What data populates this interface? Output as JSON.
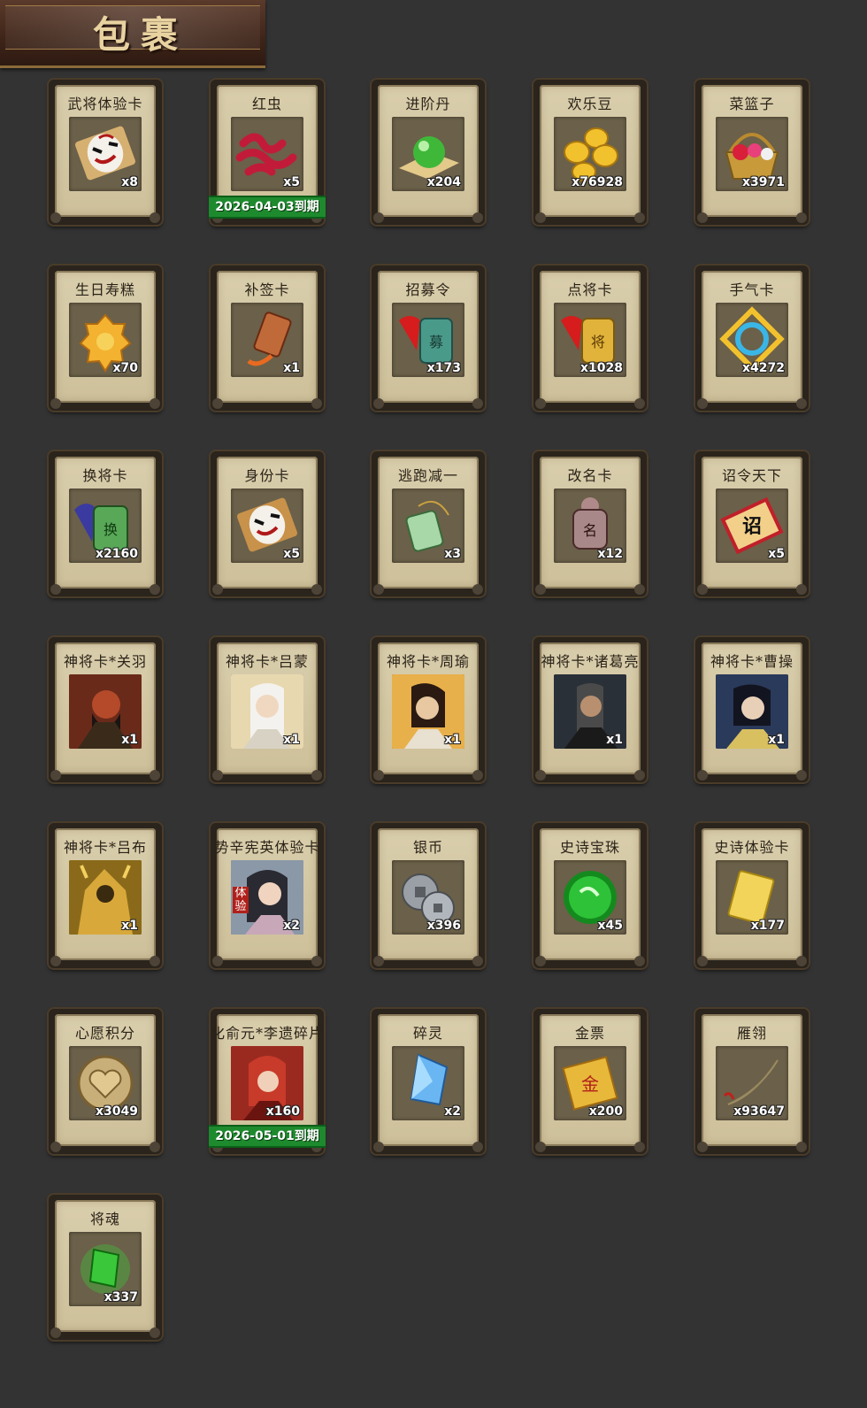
{
  "header": {
    "title": "包裹"
  },
  "items": [
    {
      "name": "武将体验卡",
      "count": "x8",
      "icon": "opera-mask-card-icon"
    },
    {
      "name": "红虫",
      "count": "x5",
      "icon": "red-worm-icon",
      "expiry": "2026-04-03到期"
    },
    {
      "name": "进阶丹",
      "count": "x204",
      "icon": "green-pill-icon"
    },
    {
      "name": "欢乐豆",
      "count": "x76928",
      "icon": "gold-beans-icon"
    },
    {
      "name": "菜篮子",
      "count": "x3971",
      "icon": "flower-basket-icon"
    },
    {
      "name": "生日寿糕",
      "count": "x70",
      "icon": "birthday-cake-icon"
    },
    {
      "name": "补签卡",
      "count": "x1",
      "icon": "sign-token-icon"
    },
    {
      "name": "招募令",
      "count": "x173",
      "icon": "recruit-token-icon"
    },
    {
      "name": "点将卡",
      "count": "x1028",
      "icon": "general-token-icon"
    },
    {
      "name": "手气卡",
      "count": "x4272",
      "icon": "luck-card-icon"
    },
    {
      "name": "换将卡",
      "count": "x2160",
      "icon": "swap-general-token-icon"
    },
    {
      "name": "身份卡",
      "count": "x5",
      "icon": "identity-mask-card-icon"
    },
    {
      "name": "逃跑减一",
      "count": "x3",
      "icon": "escape-pendant-icon"
    },
    {
      "name": "改名卡",
      "count": "x12",
      "icon": "rename-token-icon"
    },
    {
      "name": "诏令天下",
      "count": "x5",
      "icon": "decree-scroll-icon"
    },
    {
      "name": "神将卡*关羽",
      "count": "x1",
      "icon": "guan-yu-portrait-icon"
    },
    {
      "name": "神将卡*吕蒙",
      "count": "x1",
      "icon": "lv-meng-portrait-icon"
    },
    {
      "name": "神将卡*周瑜",
      "count": "x1",
      "icon": "zhou-yu-portrait-icon"
    },
    {
      "name": "神将卡*诸葛亮",
      "count": "x1",
      "icon": "zhuge-liang-portrait-icon"
    },
    {
      "name": "神将卡*曹操",
      "count": "x1",
      "icon": "cao-cao-portrait-icon"
    },
    {
      "name": "神将卡*吕布",
      "count": "x1",
      "icon": "lv-bu-portrait-icon"
    },
    {
      "name": "势辛宪英体验卡",
      "count": "x2",
      "icon": "xin-xianying-portrait-icon",
      "badge": "体验"
    },
    {
      "name": "银币",
      "count": "x396",
      "icon": "silver-coins-icon"
    },
    {
      "name": "史诗宝珠",
      "count": "x45",
      "icon": "epic-orb-icon"
    },
    {
      "name": "史诗体验卡",
      "count": "x177",
      "icon": "epic-trial-card-icon"
    },
    {
      "name": "心愿积分",
      "count": "x3049",
      "icon": "wish-heart-coin-icon"
    },
    {
      "name": "化俞元*李遗碎片",
      "count": "x160",
      "icon": "hero-fragment-portrait-icon",
      "expiry": "2026-05-01到期"
    },
    {
      "name": "碎灵",
      "count": "x2",
      "icon": "spirit-crystal-icon"
    },
    {
      "name": "金票",
      "count": "x200",
      "icon": "gold-ticket-icon"
    },
    {
      "name": "雁翎",
      "count": "x93647",
      "icon": "goose-feather-icon"
    },
    {
      "name": "将魂",
      "count": "x337",
      "icon": "general-soul-crystal-icon"
    }
  ]
}
